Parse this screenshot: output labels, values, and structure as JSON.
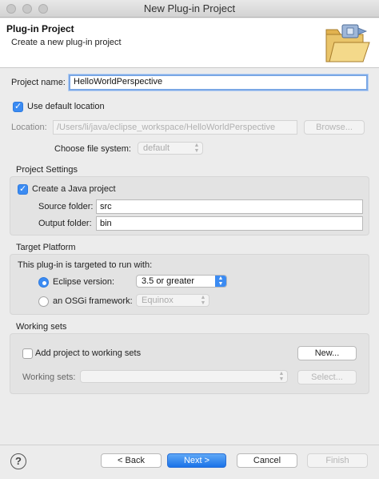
{
  "window": {
    "title": "New Plug-in Project"
  },
  "header": {
    "title": "Plug-in Project",
    "subtitle": "Create a new plug-in project"
  },
  "project": {
    "name_label": "Project name:",
    "name_value": "HelloWorldPerspective",
    "use_default_label": "Use default location",
    "use_default_checked": true,
    "location_label": "Location:",
    "location_value": "/Users/li/java/eclipse_workspace/HelloWorldPerspective",
    "browse_label": "Browse...",
    "fs_label": "Choose file system:",
    "fs_value": "default"
  },
  "project_settings": {
    "title": "Project Settings",
    "java_label": "Create a Java project",
    "java_checked": true,
    "source_label": "Source folder:",
    "source_value": "src",
    "output_label": "Output folder:",
    "output_value": "bin"
  },
  "target_platform": {
    "title": "Target Platform",
    "intro": "This plug-in is targeted to run with:",
    "eclipse_label": "Eclipse version:",
    "eclipse_value": "3.5 or greater",
    "osgi_label": "an OSGi framework:",
    "osgi_value": "Equinox"
  },
  "working_sets": {
    "title": "Working sets",
    "add_label": "Add project to working sets",
    "add_checked": false,
    "new_label": "New...",
    "sets_label": "Working sets:",
    "sets_value": "",
    "select_label": "Select..."
  },
  "footer": {
    "help": "?",
    "back": "< Back",
    "next": "Next >",
    "cancel": "Cancel",
    "finish": "Finish"
  },
  "colors": {
    "accent": "#3b8bf2",
    "group_bg": "#e3e3e3",
    "dialog_bg": "#ececec"
  }
}
